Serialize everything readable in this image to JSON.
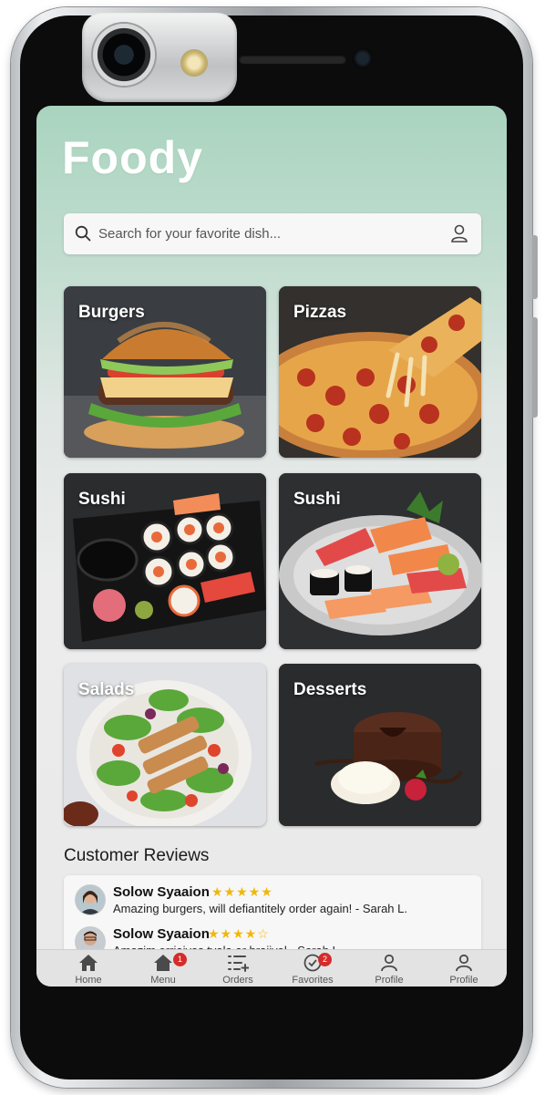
{
  "app": {
    "title": "Foody"
  },
  "search": {
    "placeholder": "Search for your favorite dish..."
  },
  "categories": [
    {
      "label": "Burgers"
    },
    {
      "label": "Pizzas"
    },
    {
      "label": "Sushi"
    },
    {
      "label": "Sushi"
    },
    {
      "label": "Salads"
    },
    {
      "label": "Desserts"
    }
  ],
  "reviews": {
    "heading": "Customer Reviews",
    "items": [
      {
        "name": "Solow Syaaion",
        "rating": 5,
        "stars": "★★★★★",
        "text": "Amazing burgers, will defiantitely order again! - Sarah L."
      },
      {
        "name": "Solow Syaaion",
        "rating": 4.5,
        "stars": "★★★★☆",
        "text": "Amazim erriaivas tvala ar hrajival - Sarah L"
      }
    ]
  },
  "tabs": [
    {
      "label": "Home",
      "icon": "home-icon"
    },
    {
      "label": "Menu",
      "icon": "house-menu-icon",
      "badge": "1"
    },
    {
      "label": "Orders",
      "icon": "orders-list-icon"
    },
    {
      "label": "Favorites",
      "icon": "favorites-icon",
      "badge": "2"
    },
    {
      "label": "Profile",
      "icon": "profile-icon"
    },
    {
      "label": "Profile",
      "icon": "profile-icon"
    }
  ],
  "colors": {
    "badge": "#d62b2b",
    "stars": "#f2b705",
    "header_mint": "#a9d4bf"
  }
}
